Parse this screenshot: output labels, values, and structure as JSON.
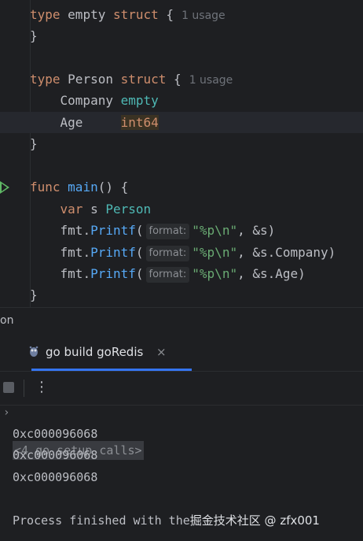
{
  "editor": {
    "lines": [
      {
        "kw": "type",
        "name": "empty",
        "kw2": "struct",
        "brace": "{",
        "usage": "1 usage"
      },
      {
        "text": "}"
      },
      {
        "text": ""
      },
      {
        "kw": "type",
        "name": "Person",
        "kw2": "struct",
        "brace": "{",
        "usage": "1 usage"
      },
      {
        "field": "Company",
        "ftype": "empty"
      },
      {
        "field": "Age",
        "ftype": "int64"
      },
      {
        "text": "}"
      },
      {
        "text": ""
      },
      {
        "kw": "func",
        "name": "main",
        "rest": "() {"
      },
      {
        "kw": "var",
        "name": "s",
        "ftype": "Person"
      },
      {
        "pkg": "fmt",
        "call": "Printf",
        "open": "(",
        "hint": "format:",
        "str": "\"%p\\n\"",
        "arg": ", &s)"
      },
      {
        "pkg": "fmt",
        "call": "Printf",
        "open": "(",
        "hint": "format:",
        "str": "\"%p\\n\"",
        "arg": ", &s.Company)"
      },
      {
        "pkg": "fmt",
        "call": "Printf",
        "open": "(",
        "hint": "format:",
        "str": "\"%p\\n\"",
        "arg": ", &s.Age)"
      },
      {
        "text": "}"
      }
    ]
  },
  "breadcrumb": {
    "text": "on"
  },
  "run_panel": {
    "tab_label": "go build goRedis",
    "close": "×",
    "more": "⋮"
  },
  "console": {
    "fold_label": "<4 go setup calls>",
    "outputs": [
      "0xc000096068",
      "0xc000096068",
      "0xc000096068"
    ],
    "finish_text": "Process finished with the",
    "watermark": "掘金技术社区 @ zfx001"
  },
  "colors": {
    "background": "#1e1f22",
    "keyword": "#cf8e6d",
    "function": "#56a8f5",
    "type": "#4fb9b5",
    "string": "#6aab73",
    "accent": "#3574f0"
  }
}
